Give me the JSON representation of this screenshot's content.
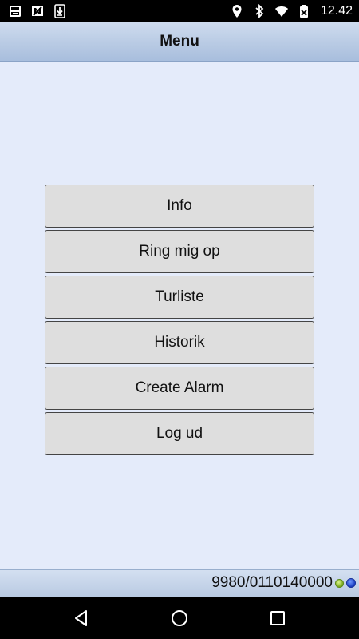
{
  "status_bar": {
    "time": "12.42",
    "left_icons": [
      "sd-card-icon",
      "no-sim-icon",
      "download-icon"
    ],
    "right_icons": [
      "location-icon",
      "bluetooth-icon",
      "wifi-icon",
      "no-battery-icon"
    ]
  },
  "header": {
    "title": "Menu"
  },
  "menu": {
    "items": [
      {
        "label": "Info"
      },
      {
        "label": "Ring mig op"
      },
      {
        "label": "Turliste"
      },
      {
        "label": "Historik"
      },
      {
        "label": "Create Alarm"
      },
      {
        "label": "Log ud"
      }
    ]
  },
  "footer": {
    "device_id": "9980/0110140000",
    "status_dots": {
      "green": "#7aa81c",
      "blue": "#1c3fc2"
    }
  },
  "colors": {
    "background": "#e4ebfa",
    "header": "#b9cbe4",
    "button": "#dedede"
  },
  "nav_bar": {
    "icons": [
      "back-icon",
      "home-icon",
      "recents-icon"
    ]
  }
}
